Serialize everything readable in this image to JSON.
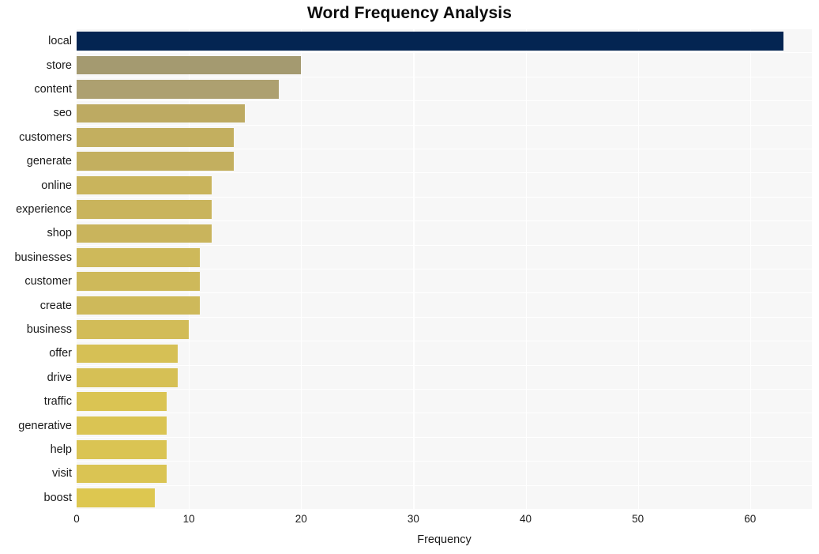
{
  "chart_data": {
    "type": "bar",
    "orientation": "horizontal",
    "title": "Word Frequency Analysis",
    "xlabel": "Frequency",
    "ylabel": "",
    "categories": [
      "local",
      "store",
      "content",
      "seo",
      "customers",
      "generate",
      "online",
      "experience",
      "shop",
      "businesses",
      "customer",
      "create",
      "business",
      "offer",
      "drive",
      "traffic",
      "generative",
      "help",
      "visit",
      "boost"
    ],
    "values": [
      63,
      20,
      18,
      15,
      14,
      14,
      12,
      12,
      12,
      11,
      11,
      11,
      10,
      9,
      9,
      8,
      8,
      8,
      8,
      7
    ],
    "xlim": [
      0,
      65.5
    ],
    "xticks": [
      0,
      10,
      20,
      30,
      40,
      50,
      60
    ],
    "xtick_labels": [
      "0",
      "10",
      "20",
      "30",
      "40",
      "50",
      "60"
    ],
    "grid": true,
    "grid_axis": "x",
    "legend": false,
    "bar_colors": [
      "#042552",
      "#a49a70",
      "#ad a070",
      "#bdaa62",
      "#c3af5f",
      "#c3af5f",
      "#c9b45c",
      "#c9b45c",
      "#c9b45c",
      "#ceb95a",
      "#ceb95a",
      "#ceb95a",
      "#d2bc58",
      "#d6c055",
      "#d6c055",
      "#dac453",
      "#dac453",
      "#dac453",
      "#dac453",
      "#ddc750"
    ],
    "plot_background": "#f7f7f7",
    "gridline_color": "#ffffff",
    "page_background": "#ffffff",
    "title_color": "#0b0b0b",
    "tick_color": "#1a1a1a"
  }
}
